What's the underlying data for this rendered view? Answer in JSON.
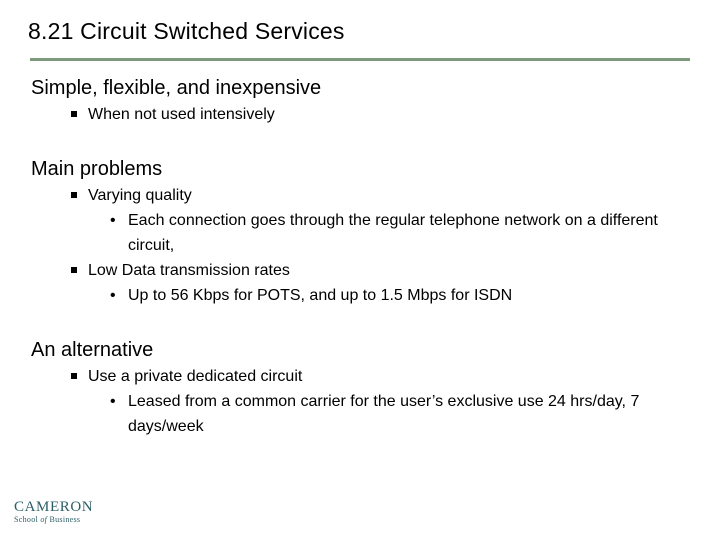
{
  "slide": {
    "title": "8.21  Circuit Switched Services",
    "rule_color": "#7d9a7d",
    "background_color": "#ffffff",
    "text_color": "#000000"
  },
  "sections": [
    {
      "heading": "Simple, flexible, and inexpensive",
      "level2": [
        {
          "text": "When not used intensively",
          "level3": []
        }
      ]
    },
    {
      "heading": "Main problems",
      "level2": [
        {
          "text": "Varying quality",
          "level3": [
            "Each connection goes through the regular telephone network on a different circuit,"
          ]
        },
        {
          "text": "Low Data transmission rates",
          "level3": [
            "Up to 56 Kbps for POTS, and up to 1.5 Mbps for ISDN"
          ]
        }
      ]
    },
    {
      "heading": "An alternative",
      "level2": [
        {
          "text": "Use a private dedicated circuit",
          "level3": [
            "Leased from a common carrier for the user’s exclusive use 24 hrs/day, 7 days/week"
          ]
        }
      ]
    }
  ],
  "bullets": {
    "level2_glyph": "square-bullet",
    "level3_glyph": "•"
  },
  "logo": {
    "name": "CAMERON",
    "sub_word1": "School",
    "sub_word2": "of",
    "sub_word3": "Business",
    "color": "#2b5f66"
  }
}
